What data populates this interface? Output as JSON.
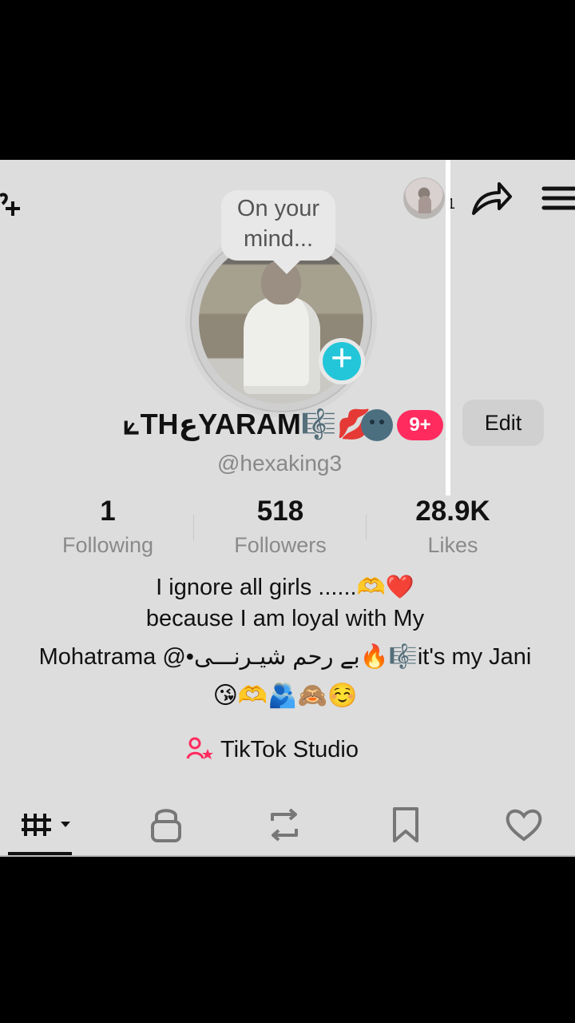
{
  "header": {
    "avatar_count": "1"
  },
  "profile": {
    "bubble_text": "On your mind...",
    "display_name": "⟀THعYARAM🎼💋",
    "notification_count": "9+",
    "edit_label": "Edit",
    "username": "@hexaking3"
  },
  "stats": {
    "following": {
      "value": "1",
      "label": "Following"
    },
    "followers": {
      "value": "518",
      "label": "Followers"
    },
    "likes": {
      "value": "28.9K",
      "label": "Likes"
    }
  },
  "bio": {
    "line1": "I ignore all girls ......🫶❤️",
    "line2": "because I am loyal with My",
    "line3": "Mohatrama @•بے رحم شیـرنـــی🔥🎼it's my Jani",
    "line4": "😘🫶🫂🙈☺️"
  },
  "studio": {
    "label": "TikTok Studio"
  },
  "colors": {
    "accent_cyan": "#23C6D9",
    "accent_pink": "#FF2B5F",
    "background": "#DDDDDD"
  },
  "icons": {
    "add_user": "add-user-icon",
    "share": "share-icon",
    "menu": "menu-icon",
    "studio": "studio-icon",
    "grid": "grid-icon",
    "lock": "lock-icon",
    "repost": "repost-icon",
    "saved": "bookmark-icon",
    "liked": "heart-icon"
  }
}
